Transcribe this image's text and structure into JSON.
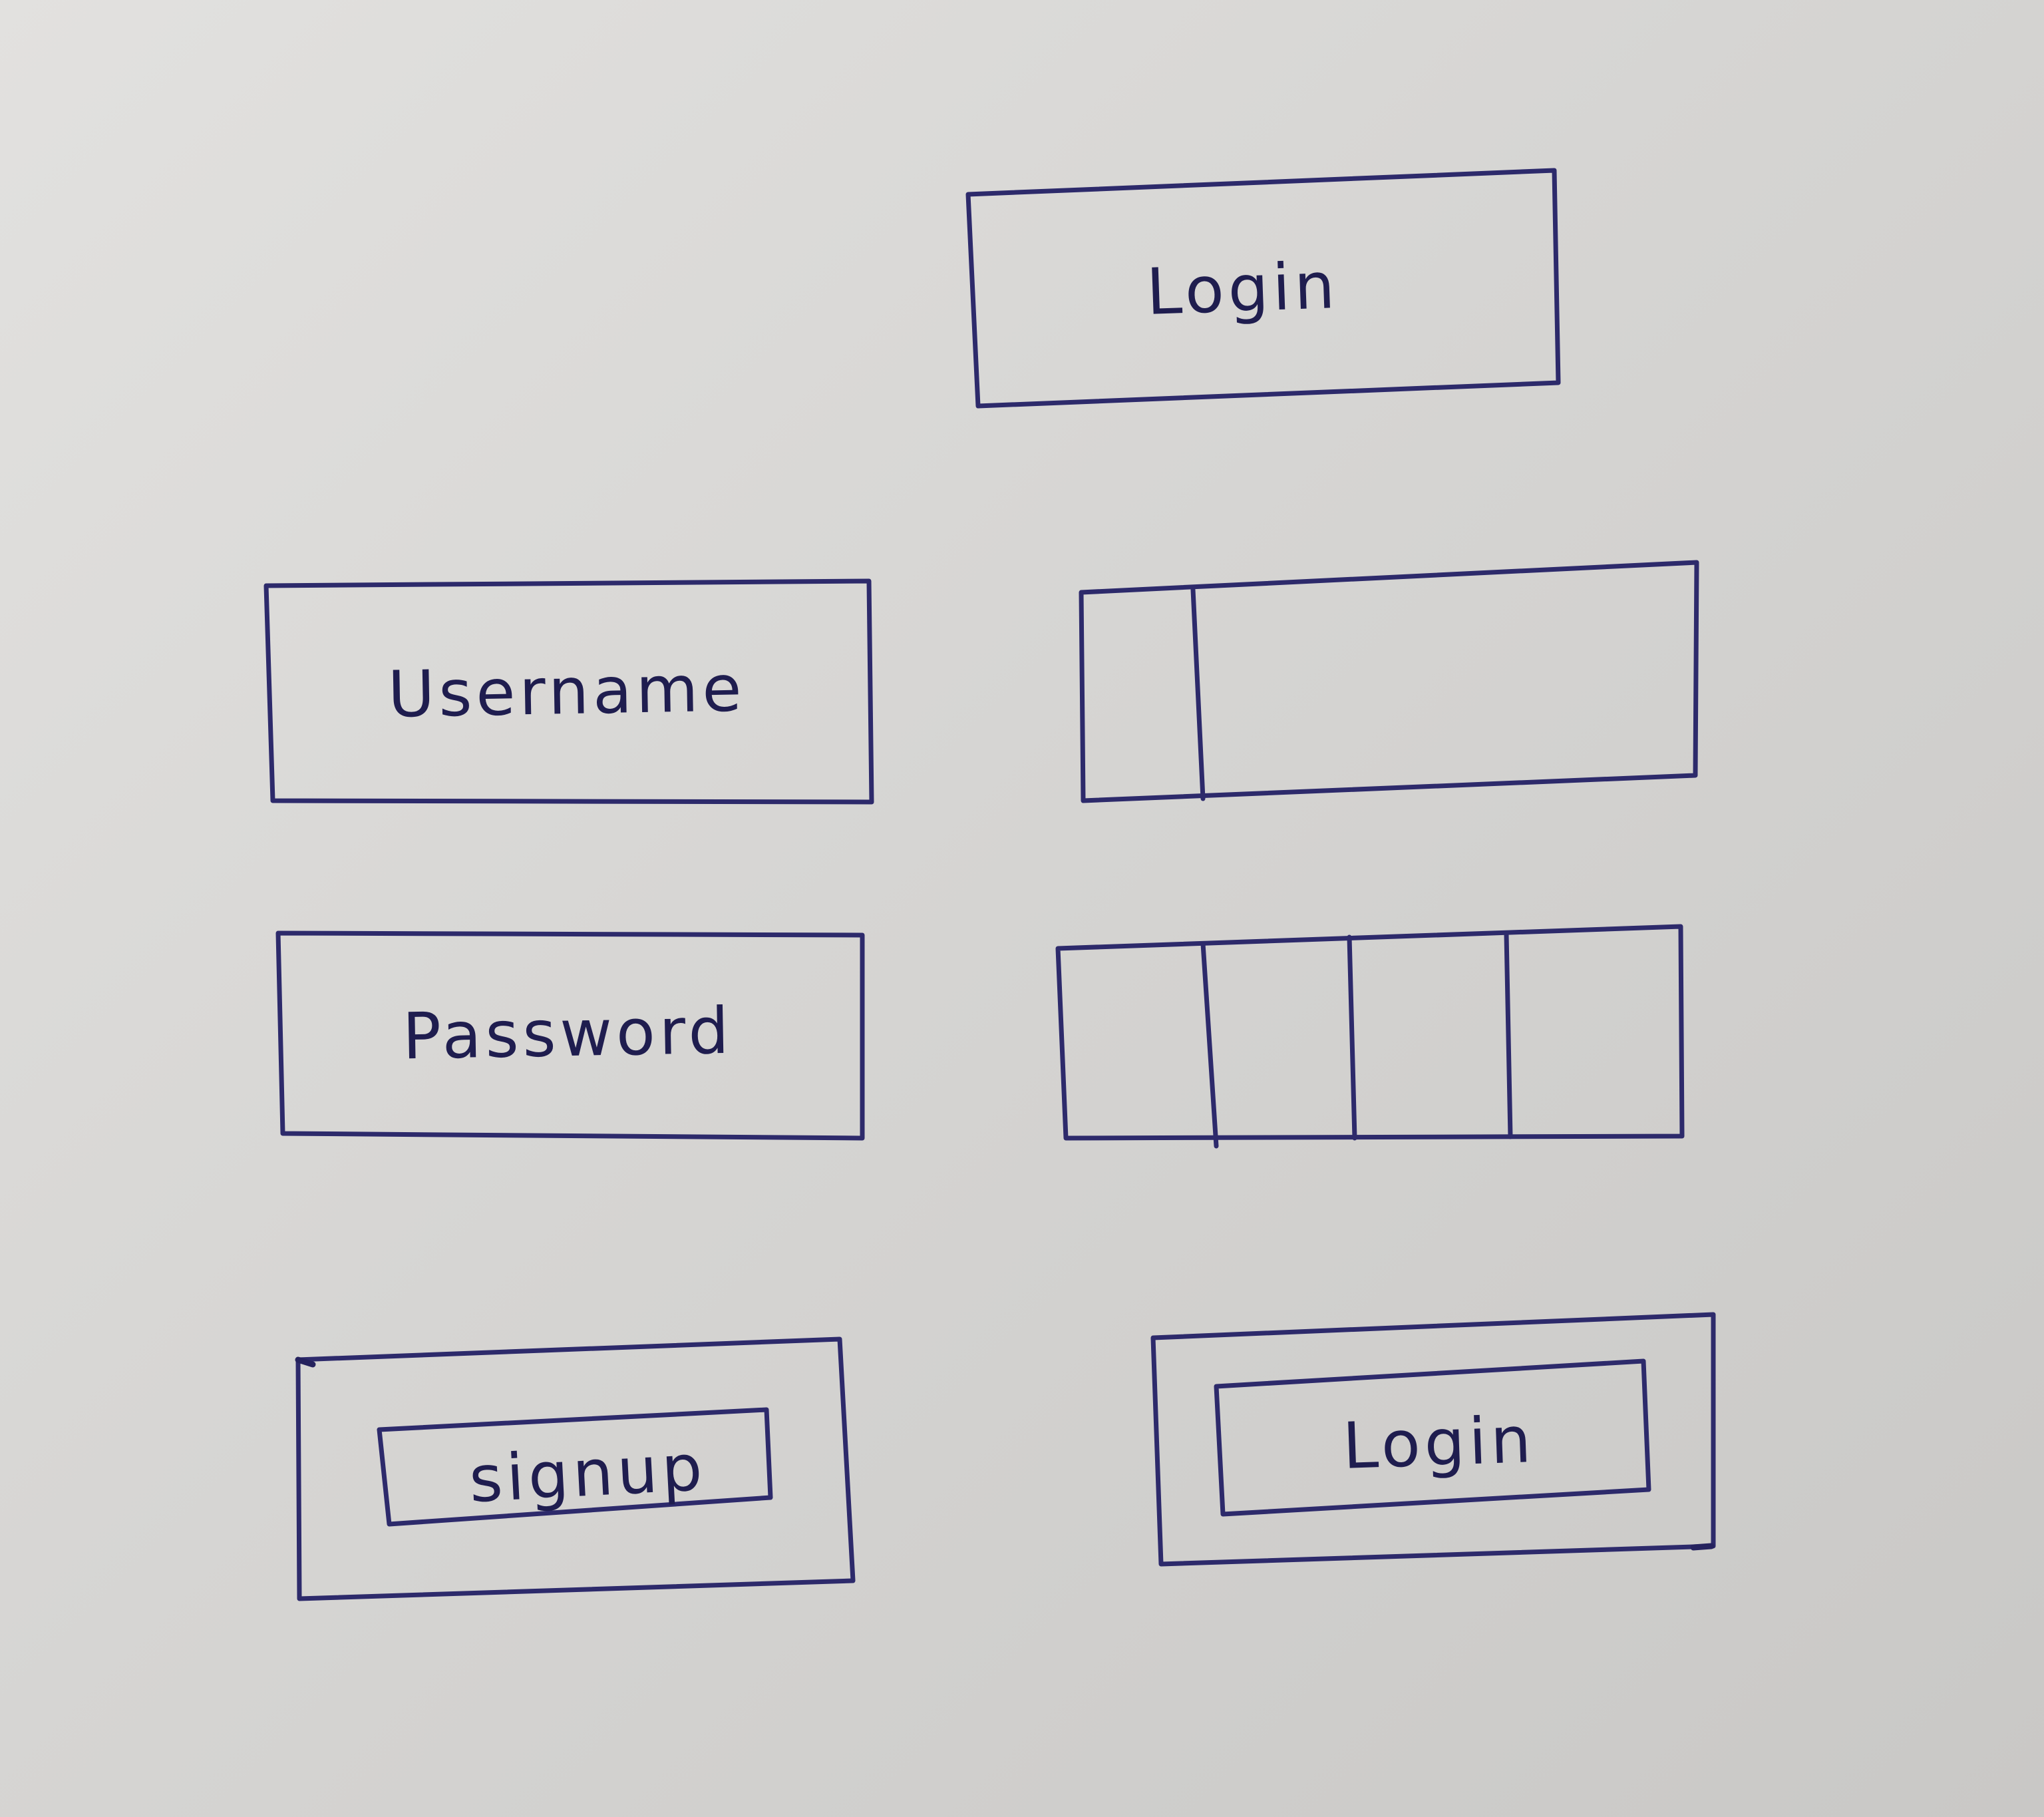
{
  "header": {
    "title": "Login"
  },
  "form": {
    "username_label": "Username",
    "password_label": "Password"
  },
  "actions": {
    "signup_label": "signup",
    "login_label": "Login"
  },
  "colors": {
    "ink": "#2d2a6b",
    "paper": "#dcdbd9"
  }
}
